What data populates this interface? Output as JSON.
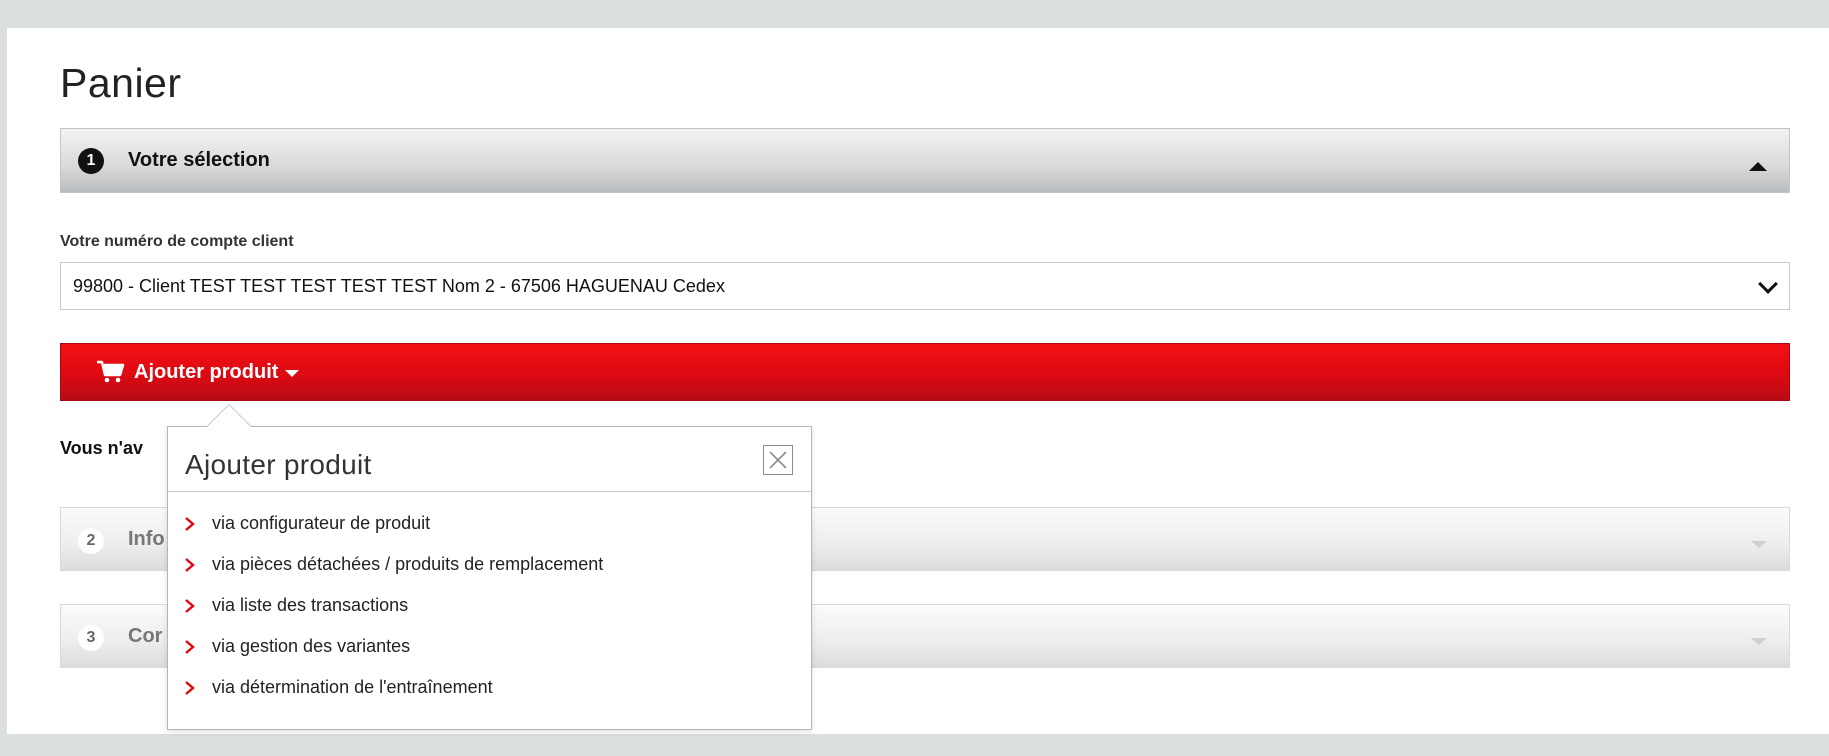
{
  "page": {
    "title": "Panier"
  },
  "sections": [
    {
      "number": "1",
      "label": "Votre sélection",
      "state": "expanded"
    },
    {
      "number": "2",
      "label": "Info",
      "state": "collapsed"
    },
    {
      "number": "3",
      "label": "Cor",
      "state": "collapsed"
    }
  ],
  "account": {
    "label": "Votre numéro de compte client",
    "selected": "99800 - Client TEST TEST TEST TEST TEST Nom 2 - 67506 HAGUENAU Cedex"
  },
  "add_product": {
    "label": "Ajouter produit",
    "icon": "cart-icon"
  },
  "notice": {
    "text": "Vous n'av"
  },
  "popover": {
    "title": "Ajouter produit",
    "close_icon": "close-icon",
    "items": [
      "via configurateur de produit",
      "via pièces détachées / produits de remplacement",
      "via liste des transactions",
      "via gestion des variantes",
      "via détermination de l'entraînement"
    ]
  },
  "colors": {
    "accent": "#e30613",
    "background": "#dcdfe0"
  }
}
